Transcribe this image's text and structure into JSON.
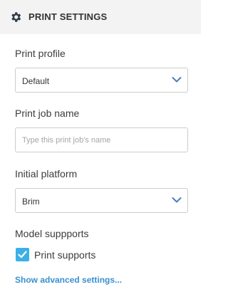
{
  "header": {
    "title": "PRINT SETTINGS",
    "icon": "gear-icon"
  },
  "print_profile": {
    "label": "Print profile",
    "value": "Default"
  },
  "print_job_name": {
    "label": "Print job name",
    "value": "",
    "placeholder": "Type this print job's name"
  },
  "initial_platform": {
    "label": "Initial platform",
    "value": "Brim"
  },
  "model_supports": {
    "label": "Model suppports",
    "checkbox_label": "Print supports",
    "checked": true
  },
  "advanced_link": {
    "label": "Show advanced settings..."
  },
  "colors": {
    "accent": "#3cb0e6",
    "link": "#3a8fd0",
    "chevron": "#4a7fc0",
    "header_bg": "#f3f3f3"
  }
}
